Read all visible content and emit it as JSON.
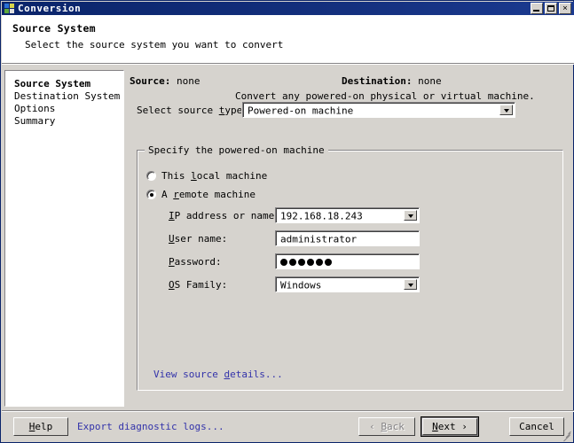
{
  "window": {
    "title": "Conversion",
    "icon": "app-window-icon",
    "controls": {
      "minimize": "minimize-icon",
      "maximize": "maximize-icon",
      "close": "close-icon"
    }
  },
  "header": {
    "title": "Source System",
    "subtitle": "Select the source system you want to convert"
  },
  "sidebar": {
    "items": [
      {
        "label": "Source System",
        "active": true
      },
      {
        "label": "Destination System",
        "active": false
      },
      {
        "label": "Options",
        "active": false
      },
      {
        "label": "Summary",
        "active": false
      }
    ]
  },
  "main": {
    "source_label": "Source:",
    "source_value": "none",
    "destination_label": "Destination:",
    "destination_value": "none",
    "source_type_label": "Select source type:",
    "source_type_value": "Powered-on machine",
    "source_type_hint": "Convert any powered-on physical or virtual machine.",
    "group": {
      "legend": "Specify the powered-on machine",
      "radios": [
        {
          "label": "This local machine",
          "checked": false
        },
        {
          "label": "A remote machine",
          "checked": true
        }
      ],
      "fields": [
        {
          "label": "IP address or name:",
          "type": "combo",
          "value": "192.168.18.243"
        },
        {
          "label": "User name:",
          "type": "text",
          "value": "administrator"
        },
        {
          "label": "Password:",
          "type": "password",
          "value": "●●●●●●",
          "dot_count": 6
        },
        {
          "label": "OS Family:",
          "type": "combo",
          "value": "Windows"
        }
      ],
      "details_link": "View source details..."
    }
  },
  "footer": {
    "help_label": "Help",
    "export_logs_label": "Export diagnostic logs...",
    "back_label": "‹ Back",
    "next_label": "Next ›",
    "cancel_label": "Cancel"
  },
  "colors": {
    "title_bar": "#0a246a",
    "face": "#d6d3ce",
    "link": "#3333aa",
    "disabled_text": "#848284"
  }
}
